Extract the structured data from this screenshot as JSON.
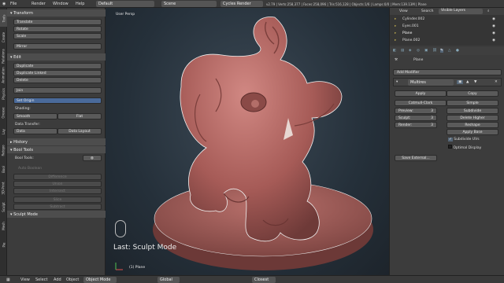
{
  "topbar": {
    "menus": [
      "File",
      "Render",
      "Window",
      "Help"
    ],
    "layout": "Default",
    "scene": "Scene",
    "engine": "Cycles Render",
    "stats": "v2.79 | Verts:258,377 | Faces:258,096 | Tris:516,128 | Objects:1/6 | Lamps:0/0 | Mem:139.13M | Plane"
  },
  "tabs": [
    "Tools",
    "Create",
    "Relations",
    "Animation",
    "Physics",
    "Grease Pencil",
    "Grease",
    "Lay",
    "Retopo",
    "Bool",
    "3D-Print",
    "Sculpt",
    "Mesh",
    "Pie"
  ],
  "tools": {
    "transform_header": "Transform",
    "translate": "Translate",
    "rotate": "Rotate",
    "scale": "Scale",
    "mirror": "Mirror",
    "edit_header": "Edit",
    "duplicate": "Duplicate",
    "duplicate_linked": "Duplicate Linked",
    "delete": "Delete",
    "join": "Join",
    "set_origin": "Set Origin",
    "shading_label": "Shading:",
    "smooth": "Smooth",
    "flat": "Flat",
    "data_transfer_label": "Data Transfer:",
    "data": "Data",
    "data_layout": "Data Layout",
    "history_header": "History",
    "bool_header": "Bool Tools",
    "bool_tools_label": "Bool Tools:",
    "auto_boolean": "Auto Boolean",
    "difference": "Difference",
    "union": "Union",
    "intersect": "Intersect",
    "slice": "Slice",
    "subtract": "Subtract",
    "sculpt_mode_header": "Sculpt Mode"
  },
  "viewport": {
    "label": "User Persp",
    "last_op": "Last: Sculpt Mode",
    "object": "(1) Plane"
  },
  "outliner": {
    "view": "View",
    "search": "Search",
    "filter": "Visible Layers",
    "items": [
      "Cylinder.002",
      "Eyes.001",
      "Plane",
      "Plane.002"
    ]
  },
  "properties": {
    "object_name": "Plane",
    "add_modifier": "Add Modifier",
    "modifier_name": "Multires",
    "apply": "Apply",
    "copy": "Copy",
    "catmull_clark": "Catmull-Clark",
    "simple": "Simple",
    "preview_label": "Preview:",
    "preview_val": "3",
    "sculpt_label": "Sculpt:",
    "sculpt_val": "3",
    "render_label": "Render:",
    "render_val": "3",
    "subdivide": "Subdivide",
    "delete_higher": "Delete Higher",
    "reshape": "Reshape",
    "apply_base": "Apply Base",
    "subdivide_uvs": "Subdivide UVs",
    "optimal_display": "Optimal Display",
    "save_external": "Save External..."
  },
  "statusbar": {
    "view": "View",
    "select": "Select",
    "add": "Add",
    "object": "Object",
    "mode": "Object Mode",
    "pivot": "Global",
    "snap": "Closest"
  },
  "colors": {
    "accent": "#4a6a9a",
    "sculpt": "#b96a66"
  }
}
